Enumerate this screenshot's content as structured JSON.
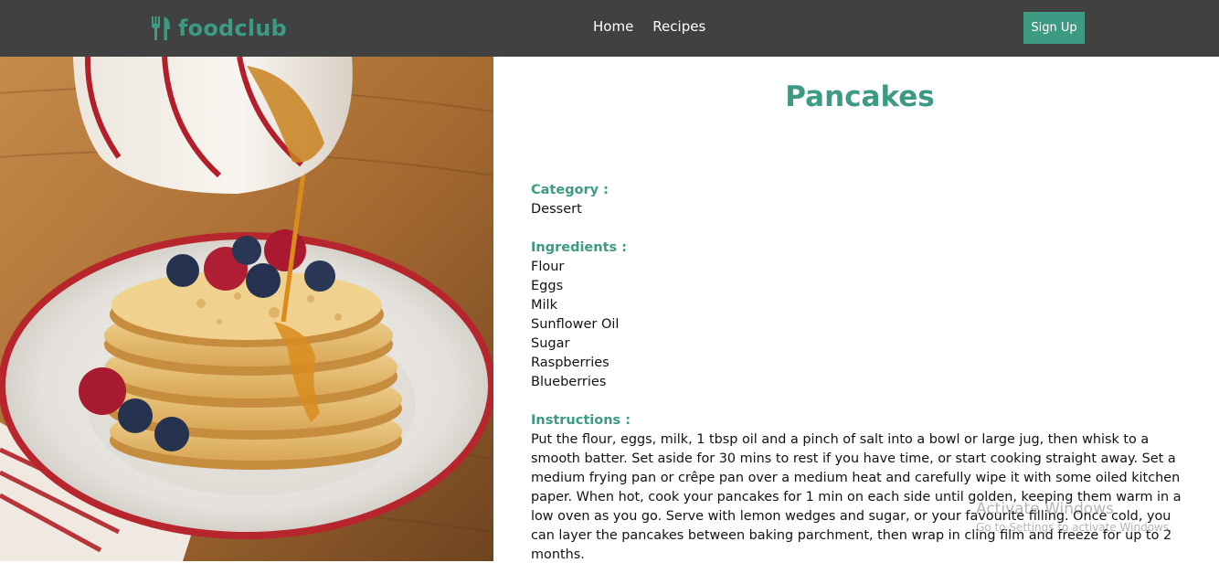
{
  "navbar": {
    "brand_name": "foodclub",
    "links": [
      {
        "label": "Home"
      },
      {
        "label": "Recipes"
      }
    ],
    "signup_label": "Sign Up"
  },
  "recipe": {
    "title": "Pancakes",
    "category_label": "Category :",
    "category": "Dessert",
    "ingredients_label": "Ingredients :",
    "ingredients": [
      "Flour",
      "Eggs",
      "Milk",
      "Sunflower Oil",
      "Sugar",
      "Raspberries",
      "Blueberries"
    ],
    "instructions_label": "Instructions :",
    "instructions": "Put the flour, eggs, milk, 1 tbsp oil and a pinch of salt into a bowl or large jug, then whisk to a smooth batter. Set aside for 30 mins to rest if you have time, or start cooking straight away. Set a medium frying pan or crêpe pan over a medium heat and carefully wipe it with some oiled kitchen paper. When hot, cook your pancakes for 1 min on each side until golden, keeping them warm in a low oven as you go. Serve with lemon wedges and sugar, or your favourite filling. Once cold, you can layer the pancakes between baking parchment, then wrap in cling film and freeze for up to 2 months."
  },
  "watermark": {
    "title": "Activate Windows",
    "subtitle": "Go to Settings to activate Windows."
  },
  "colors": {
    "brand": "#3d9a83",
    "navbar_bg": "#414141"
  },
  "icons": {
    "logo": "fork-knife-icon"
  }
}
